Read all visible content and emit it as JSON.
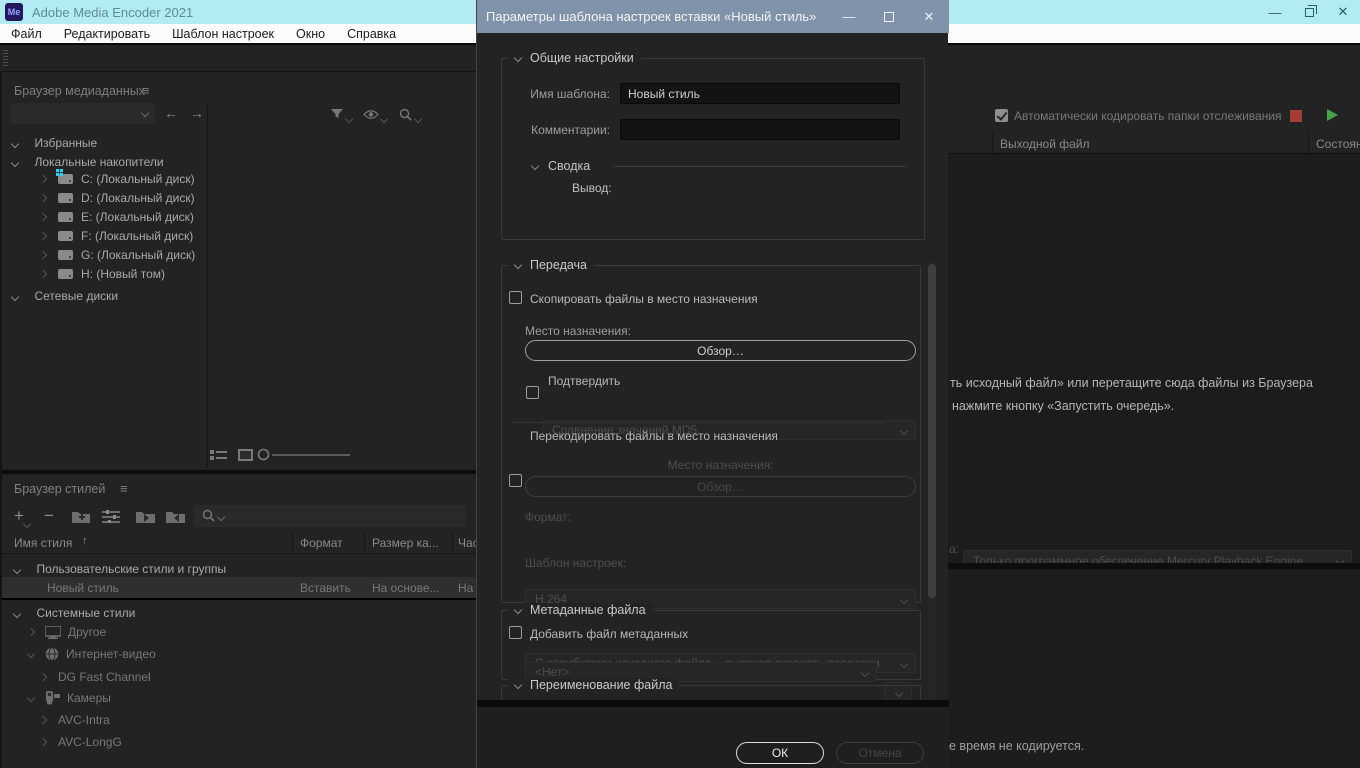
{
  "colors": {
    "titlebar": "#b2ecf2",
    "dialog_titlebar": "#8093aa",
    "stop_red": "#a23c36",
    "play_green": "#4aa34a",
    "drive_accent": "#35c8e8"
  },
  "app": {
    "logo_text": "Me",
    "title": "Adobe Media Encoder 2021",
    "menus": [
      "Файл",
      "Редактировать",
      "Шаблон настроек",
      "Окно",
      "Справка"
    ]
  },
  "media_browser": {
    "title": "Браузер медиаданных",
    "tree": [
      {
        "label": "Избранные"
      },
      {
        "label": "Локальные накопители"
      },
      {
        "label": "C: (Локальный диск)"
      },
      {
        "label": "D: (Локальный диск)"
      },
      {
        "label": "E: (Локальный диск)"
      },
      {
        "label": "F: (Локальный диск)"
      },
      {
        "label": "G: (Локальный диск)"
      },
      {
        "label": "H: (Новый том)"
      },
      {
        "label": "Сетевые диски"
      }
    ]
  },
  "preset_browser": {
    "title": "Браузер стилей",
    "columns": {
      "name": "Имя стиля",
      "format": "Формат",
      "frame_size": "Размер ка...",
      "frame_rate": "Часто"
    },
    "user_group": "Пользовательские стили и группы",
    "preset_row": {
      "name": "Новый стиль",
      "format": "Вставить",
      "frame_size": "На основе...",
      "frame_rate": "На ос"
    },
    "system_group": "Системные стили",
    "system_items": [
      "Другое",
      "Интернет-видео",
      "DG Fast Channel",
      "Камеры",
      "AVC-Intra",
      "AVC-LongG"
    ]
  },
  "queue": {
    "watch_label": "Автоматически кодировать папки отслеживания",
    "col_output": "Выходной файл",
    "col_status": "Состояни",
    "hint_line1": "ть исходный файл» или перетащите сюда файлы из Браузера",
    "hint_line2": "нажмите кнопку «Запустить очередь».",
    "renderer_label_fragment": "а:",
    "renderer_value": "Только программное обеспечение Mercury Playback Engine",
    "status_text": "е время не кодируется."
  },
  "dialog": {
    "title": "Параметры шаблона настроек вставки «Новый стиль»",
    "general": {
      "header": "Общие настройки",
      "name_label": "Имя шаблона:",
      "name_value": "Новый стиль",
      "comments_label": "Комментарии:",
      "summary_header": "Сводка",
      "output_label": "Вывод:"
    },
    "transfer": {
      "header": "Передача",
      "copy_label": "Скопировать файлы в место назначения",
      "dest_label": "Место назначения:",
      "browse_label": "Обзор…",
      "verify_label": "Подтвердить",
      "verify_value": "Сравнение значений MD5",
      "transcode_label": "Перекодировать файлы в место назначения",
      "dest2_label": "Место назначения:",
      "browse2_label": "Обзор…",
      "format_label": "Формат:",
      "format_value": "H.264",
      "preset_label": "Шаблон настроек:",
      "preset_value": "С атрибутами исходного файла – высокая скорость передачи"
    },
    "metadata": {
      "header": "Метаданные файла",
      "add_label": "Добавить файл метаданных",
      "value": "<Нет>"
    },
    "rename": {
      "header": "Переименование файла"
    },
    "ok_label": "ОК",
    "cancel_label": "Отмена"
  }
}
